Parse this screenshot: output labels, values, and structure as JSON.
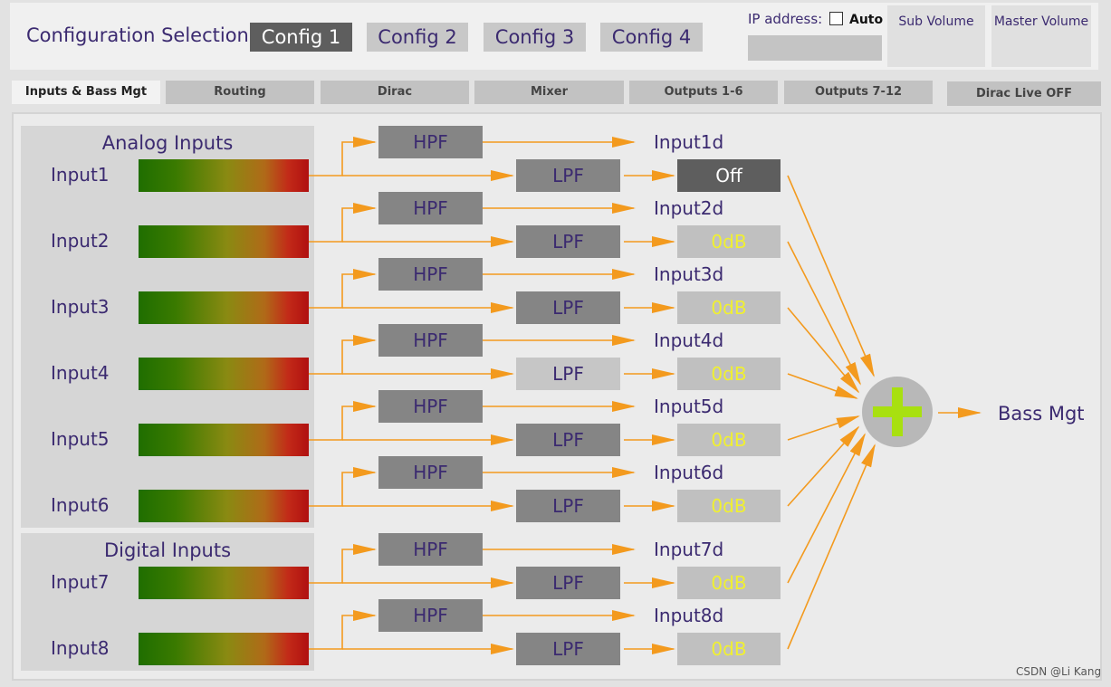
{
  "header": {
    "config_label": "Configuration Selection:",
    "configs": [
      "Config 1",
      "Config 2",
      "Config 3",
      "Config 4"
    ],
    "active_config": 0,
    "ip_label": "IP address:",
    "auto_label": "Auto",
    "auto_checked": false,
    "ip_value": "",
    "sub_volume_label": "Sub Volume",
    "master_volume_label": "Master Volume"
  },
  "tabs": [
    "Inputs & Bass Mgt",
    "Routing",
    "Dirac",
    "Mixer",
    "Outputs 1-6",
    "Outputs 7-12"
  ],
  "active_tab": 0,
  "dirac_toggle_label": "Dirac Live OFF",
  "groups": {
    "analog_title": "Analog Inputs",
    "digital_title": "Digital Inputs"
  },
  "filters": {
    "hpf_label": "HPF",
    "lpf_label": "LPF"
  },
  "inputs": [
    {
      "label": "Input1",
      "output_label": "Input1d",
      "gain": "Off",
      "lpf_disabled": false
    },
    {
      "label": "Input2",
      "output_label": "Input2d",
      "gain": "0dB",
      "lpf_disabled": false
    },
    {
      "label": "Input3",
      "output_label": "Input3d",
      "gain": "0dB",
      "lpf_disabled": false
    },
    {
      "label": "Input4",
      "output_label": "Input4d",
      "gain": "0dB",
      "lpf_disabled": true
    },
    {
      "label": "Input5",
      "output_label": "Input5d",
      "gain": "0dB",
      "lpf_disabled": false
    },
    {
      "label": "Input6",
      "output_label": "Input6d",
      "gain": "0dB",
      "lpf_disabled": false
    },
    {
      "label": "Input7",
      "output_label": "Input7d",
      "gain": "0dB",
      "lpf_disabled": false
    },
    {
      "label": "Input8",
      "output_label": "Input8d",
      "gain": "0dB",
      "lpf_disabled": false
    }
  ],
  "summing_icon": "plus-icon",
  "bass_mgt_label": "Bass Mgt",
  "watermark": "CSDN @Li Kang",
  "colors": {
    "accent": "#f39a1e",
    "active_button": "#5e5e5e",
    "text": "#3b2a70",
    "gain_text": "#f0f030",
    "plus": "#a8e010"
  }
}
